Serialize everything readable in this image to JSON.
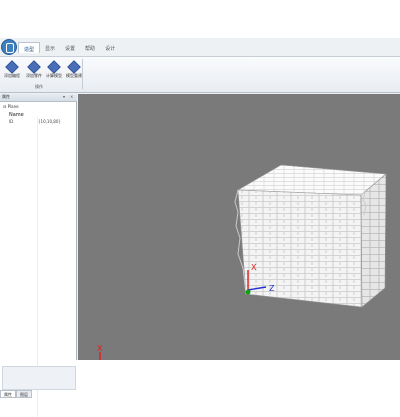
{
  "ribbon_tabs": [
    "造型",
    "显示",
    "设置",
    "帮助",
    "设计"
  ],
  "ribbon_buttons": [
    "添加编程",
    "添加零件",
    "计算模型",
    "模型重建"
  ],
  "ribbon_group_label": "操作",
  "panel": {
    "title": "属性",
    "pin_icon": "pin-icon",
    "close_icon": "close-icon",
    "tree_root": "Plane",
    "name_header": "Name",
    "property_row": {
      "key": "ID",
      "value": "{10,10,80}"
    },
    "tabs": [
      "属性",
      "图层"
    ]
  },
  "viewport": {
    "background": "#7a7a7a",
    "axis_colors": {
      "x": "#e02020",
      "y": "#10a010",
      "z": "#2030d0"
    },
    "axis_labels": {
      "x": "X",
      "y": "Y",
      "z": "Z"
    }
  }
}
